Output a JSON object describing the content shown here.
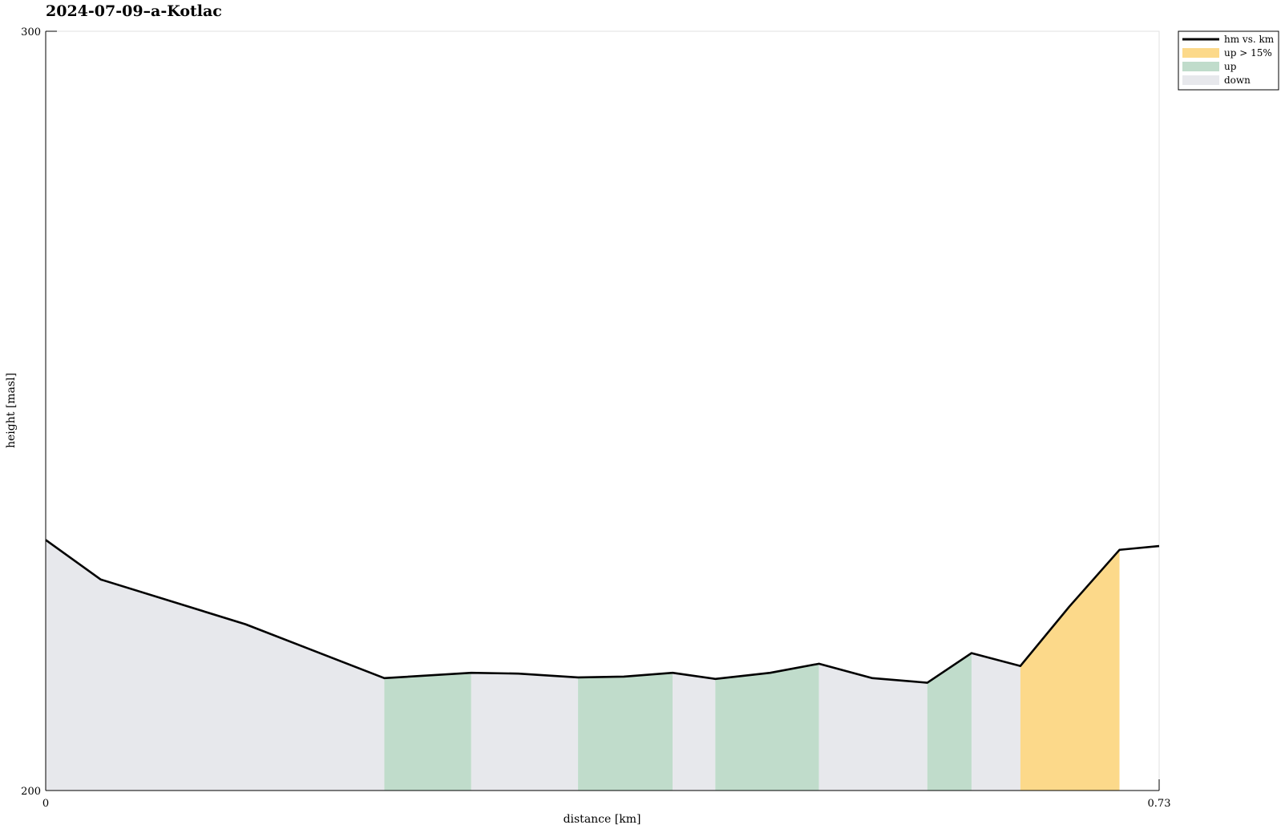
{
  "chart_data": {
    "type": "area",
    "title": "2024-07-09–a-Kotlac",
    "xlabel": "distance [km]",
    "ylabel": "height [masl]",
    "xlim": [
      0,
      0.73
    ],
    "ylim": [
      200,
      300
    ],
    "xticks": [
      "0",
      "0.73"
    ],
    "yticks": [
      "300",
      "200"
    ],
    "grid": false,
    "legend_placement": "outside top-right",
    "colors": {
      "line": "#000000",
      "up_steep": "#fcd98a",
      "up": "#c0dccb",
      "down": "#e7e8ec"
    },
    "series": [
      {
        "name": "hm vs. km",
        "x": [
          0,
          0.036,
          0.131,
          0.222,
          0.279,
          0.31,
          0.349,
          0.379,
          0.411,
          0.439,
          0.475,
          0.507,
          0.542,
          0.578,
          0.607,
          0.639,
          0.671,
          0.704,
          0.73
        ],
        "y": [
          233.0,
          227.8,
          221.9,
          214.8,
          215.5,
          215.4,
          214.9,
          215.0,
          215.5,
          214.7,
          215.5,
          216.7,
          214.8,
          214.2,
          218.1,
          216.4,
          224.2,
          231.7,
          232.2
        ]
      }
    ],
    "segments": [
      {
        "x0": 0,
        "x1": 0.222,
        "class": "down"
      },
      {
        "x0": 0.222,
        "x1": 0.279,
        "class": "up"
      },
      {
        "x0": 0.279,
        "x1": 0.349,
        "class": "down"
      },
      {
        "x0": 0.349,
        "x1": 0.411,
        "class": "up"
      },
      {
        "x0": 0.411,
        "x1": 0.439,
        "class": "down"
      },
      {
        "x0": 0.439,
        "x1": 0.507,
        "class": "up"
      },
      {
        "x0": 0.507,
        "x1": 0.578,
        "class": "down"
      },
      {
        "x0": 0.578,
        "x1": 0.607,
        "class": "up"
      },
      {
        "x0": 0.607,
        "x1": 0.639,
        "class": "down"
      },
      {
        "x0": 0.639,
        "x1": 0.704,
        "class": "up_steep"
      }
    ],
    "legend": [
      {
        "label": "hm vs. km",
        "kind": "line",
        "class": "line"
      },
      {
        "label": "up > 15%",
        "kind": "patch",
        "class": "up_steep"
      },
      {
        "label": "up",
        "kind": "patch",
        "class": "up"
      },
      {
        "label": "down",
        "kind": "patch",
        "class": "down"
      }
    ]
  }
}
